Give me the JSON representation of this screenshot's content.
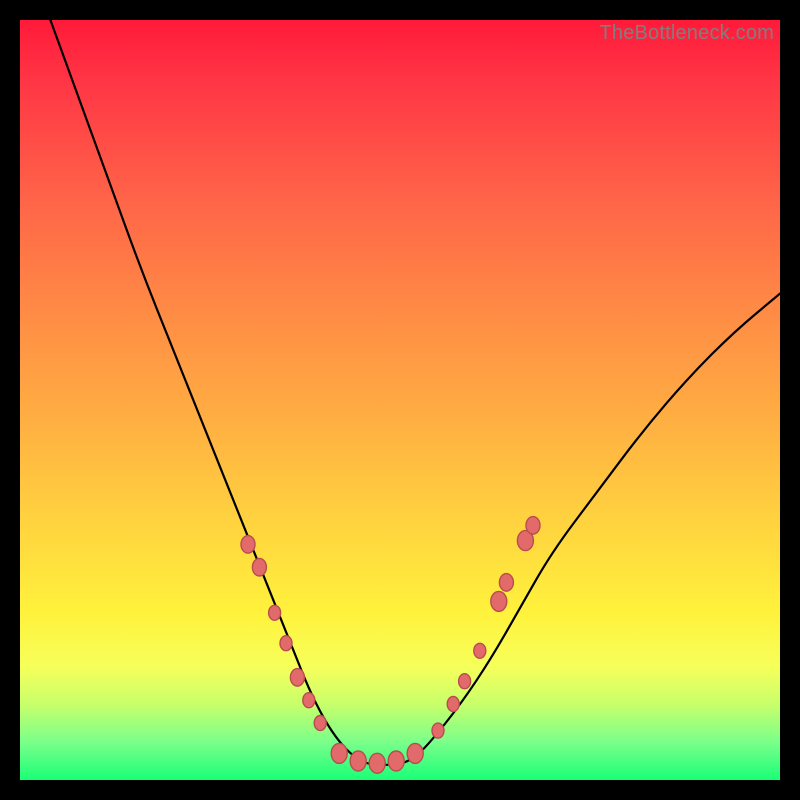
{
  "watermark": "TheBottleneck.com",
  "colors": {
    "frame": "#000000",
    "gradient_top": "#ff1a3a",
    "gradient_bottom": "#1aff77",
    "curve": "#000000",
    "dot_fill": "#e36a6a",
    "dot_stroke": "#b84d4d"
  },
  "chart_data": {
    "type": "line",
    "title": "",
    "xlabel": "",
    "ylabel": "",
    "xlim": [
      0,
      100
    ],
    "ylim": [
      0,
      100
    ],
    "note": "V-shaped bottleneck curve over vertical red→green gradient. Axes unlabeled; values are positional estimates in percent of plot width/height (y=0 at bottom).",
    "series": [
      {
        "name": "bottleneck-curve",
        "x": [
          4,
          8,
          12,
          16,
          20,
          24,
          28,
          30,
          32,
          34,
          36,
          38,
          40,
          42,
          44,
          46,
          48,
          50,
          52,
          54,
          58,
          62,
          66,
          70,
          76,
          82,
          88,
          94,
          100
        ],
        "y": [
          100,
          89,
          78,
          67,
          57,
          47,
          37,
          32,
          27,
          22,
          17,
          12,
          8,
          5,
          3,
          2,
          2,
          2,
          3,
          5,
          10,
          16,
          23,
          30,
          38,
          46,
          53,
          59,
          64
        ]
      }
    ],
    "markers": {
      "name": "highlight-dots",
      "comment": "Salmon dots clustered near the trough on both branches.",
      "points": [
        {
          "x": 30.0,
          "y": 31.0,
          "r": 7
        },
        {
          "x": 31.5,
          "y": 28.0,
          "r": 7
        },
        {
          "x": 33.5,
          "y": 22.0,
          "r": 6
        },
        {
          "x": 35.0,
          "y": 18.0,
          "r": 6
        },
        {
          "x": 36.5,
          "y": 13.5,
          "r": 7
        },
        {
          "x": 38.0,
          "y": 10.5,
          "r": 6
        },
        {
          "x": 39.5,
          "y": 7.5,
          "r": 6
        },
        {
          "x": 42.0,
          "y": 3.5,
          "r": 8
        },
        {
          "x": 44.5,
          "y": 2.5,
          "r": 8
        },
        {
          "x": 47.0,
          "y": 2.2,
          "r": 8
        },
        {
          "x": 49.5,
          "y": 2.5,
          "r": 8
        },
        {
          "x": 52.0,
          "y": 3.5,
          "r": 8
        },
        {
          "x": 55.0,
          "y": 6.5,
          "r": 6
        },
        {
          "x": 57.0,
          "y": 10.0,
          "r": 6
        },
        {
          "x": 58.5,
          "y": 13.0,
          "r": 6
        },
        {
          "x": 60.5,
          "y": 17.0,
          "r": 6
        },
        {
          "x": 63.0,
          "y": 23.5,
          "r": 8
        },
        {
          "x": 64.0,
          "y": 26.0,
          "r": 7
        },
        {
          "x": 66.5,
          "y": 31.5,
          "r": 8
        },
        {
          "x": 67.5,
          "y": 33.5,
          "r": 7
        }
      ]
    }
  }
}
